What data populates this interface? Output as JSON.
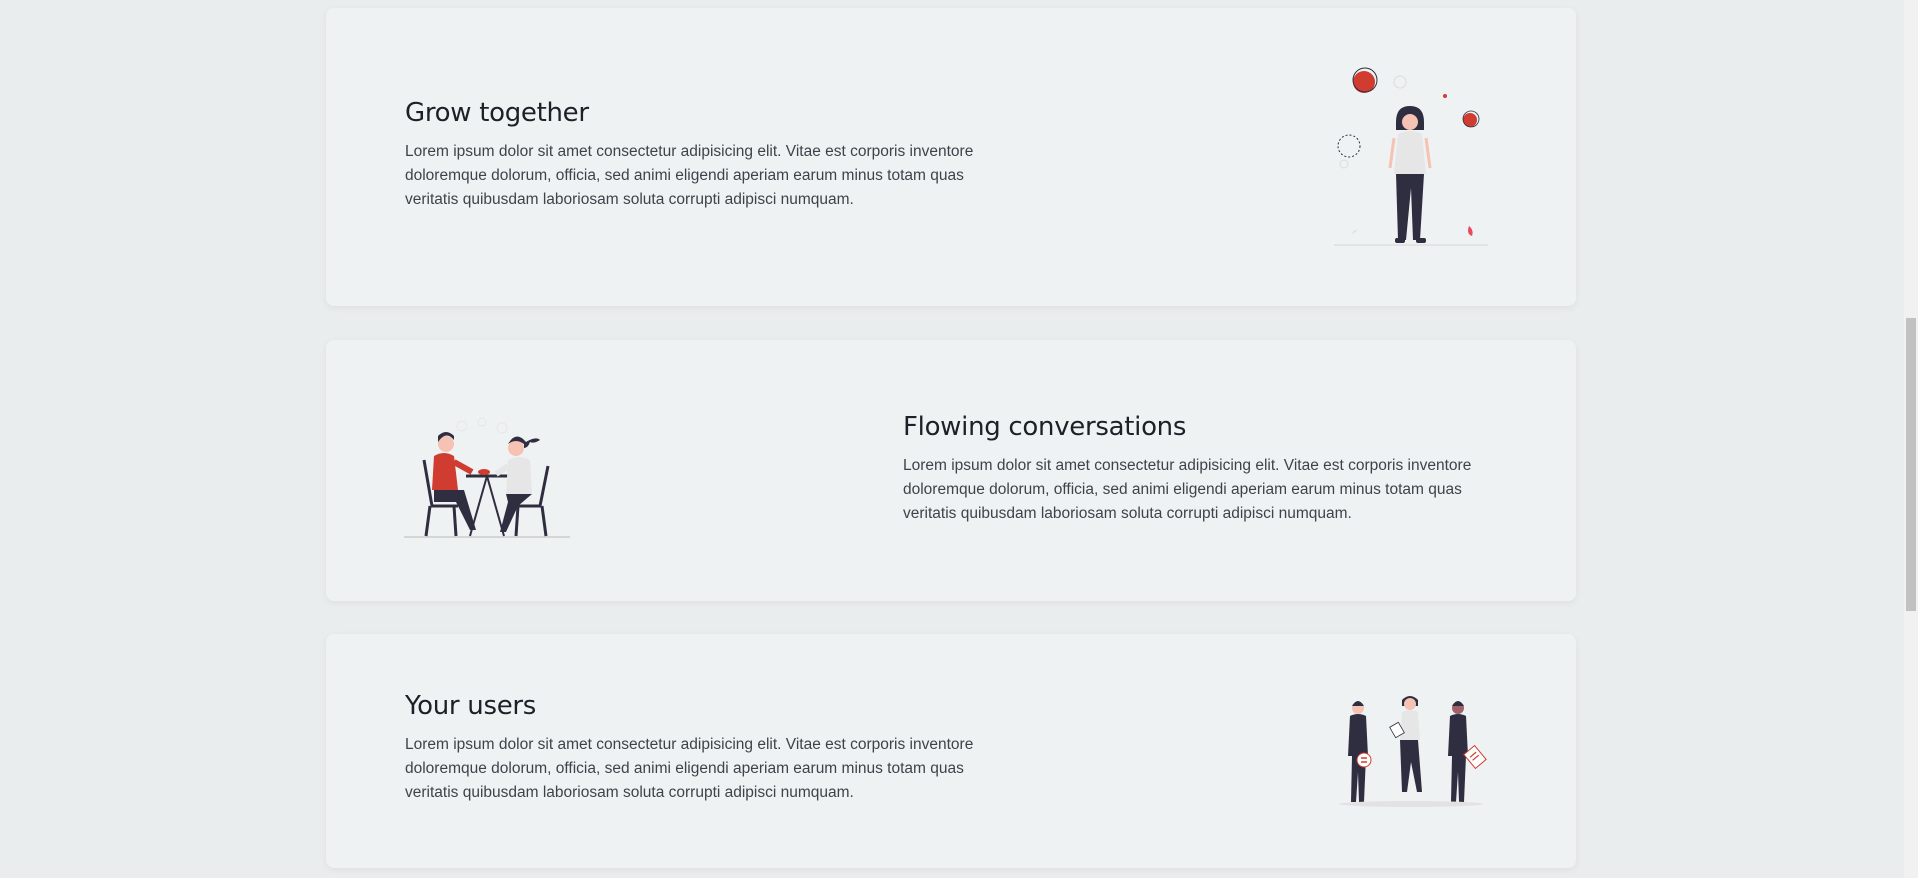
{
  "features": [
    {
      "title": "Grow together",
      "description": "Lorem ipsum dolor sit amet consectetur adipisicing elit. Vitae est corporis inventore doloremque dolorum, officia, sed animi eligendi aperiam earum minus totam quas veritatis quibusdam laboriosam soluta corrupti adipisci numquam.",
      "illustration": "woman-with-balloons-illustration"
    },
    {
      "title": "Flowing conversations",
      "description": "Lorem ipsum dolor sit amet consectetur adipisicing elit. Vitae est corporis inventore doloremque dolorum, officia, sed animi eligendi aperiam earum minus totam quas veritatis quibusdam laboriosam soluta corrupti adipisci numquam.",
      "illustration": "two-people-at-table-illustration"
    },
    {
      "title": "Your users",
      "description": "Lorem ipsum dolor sit amet consectetur adipisicing elit. Vitae est corporis inventore doloremque dolorum, officia, sed animi eligendi aperiam earum minus totam quas veritatis quibusdam laboriosam soluta corrupti adipisci numquam.",
      "illustration": "three-users-illustration"
    }
  ],
  "colors": {
    "accent": "#d03c2f",
    "dark": "#2f2e41",
    "card_background": "#eff2f3",
    "page_background": "#eaedee"
  }
}
